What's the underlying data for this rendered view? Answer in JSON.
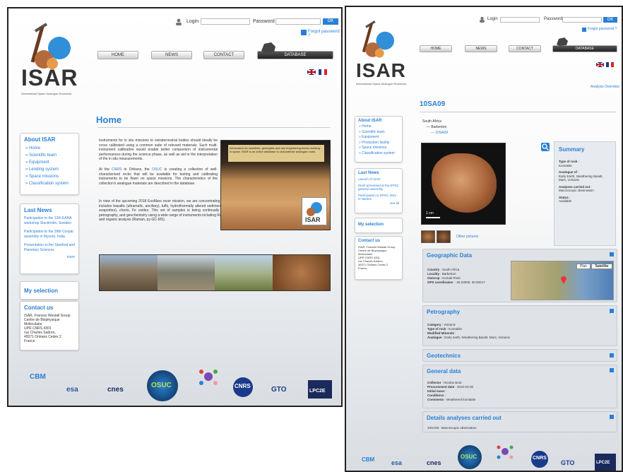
{
  "header": {
    "login_label": "Login",
    "password_label": "Password",
    "ok_label": "OK",
    "forgot_password": "Forgot password ?",
    "logo_text": "ISAR",
    "logo_subtitle": "International Space Analogue Rockstore"
  },
  "nav": {
    "home": "HOME",
    "news": "NEWS",
    "contact": "CONTACT",
    "database": "DATABASE"
  },
  "languages": [
    "en-flag-icon",
    "fr-flag-icon"
  ],
  "left_page": {
    "title": "Home",
    "intro_1": "Instruments for in situ missions to extraterrestrial bodies should ideally be cross calibrated using a common suite of relevant materials. Such multi-instrument calibration would enable better comparison of instrumental performances during the science phase, as well as aid in the interpretation of the in situ measurements.",
    "intro_2_prefix": "At the",
    "cnrs": "CNRS",
    "intro_2_mid": "in Orléans, the",
    "osuc": "OSUC",
    "intro_2_rest": "is creating a collection of well-characterised rocks that will be available for testing and calibrating instruments to be flown on space missions. The characteristics of the collection's analogue materials are described in the database.",
    "intro_3": "In view of the upcoming 2018 ExoMars rover mission, we are concentrating initially on materials of direct relevance to Mars. The initial collection includes basaltic (ultramafic, ancillary), tuffs, hydrothermally altered sediments, volcanic, sedimentary, banded iron formations, sub-surface (chert, evaporites), cherts, Fe oxides. This set of samples is being continually increased. All samples have been characterised with microscopy, petrography, and geochemistry using a wide range of instruments including Raman and IR spectrometry, elemental analysis (SEM, microprobe, ICP) and organic analysis (Raman, py-GC-MS).",
    "feature_caption": "Information for scientists, geologists and any engineering teams working in space. ISAR is an online database to characterise analogue rocks.",
    "about": {
      "title": "About ISAR",
      "items": [
        "Home",
        "Scientific team",
        "Equipment",
        "Lending system",
        "Space missions",
        "Classification system"
      ]
    },
    "news": {
      "title": "Last News",
      "items": [
        "Participation to the 12th EANA workshop Stockholm, Sweden",
        "Participation to the 39th Cospar assembly in Mysore, India",
        "Presentation to the Stanford and Planetary Sciences"
      ],
      "more": "more"
    },
    "my_selection": "My selection",
    "contact": {
      "title": "Contact us",
      "lines": [
        "ISAR, Frances Westall Group",
        "Centre de Biophysique",
        "Moléculaire",
        "UPR CNRS 4301",
        "rue Charles Sadron,",
        "45071 Orléans Cedex 2",
        "France"
      ]
    }
  },
  "right_page": {
    "analyses_link": "Analysis Overview",
    "sample_id": "10SA09",
    "breadcrumb": [
      "South Africa",
      "Barberton",
      "10SA09"
    ],
    "scale_bar": "1 cm",
    "other_pictures": "Other pictures",
    "summary": {
      "title": "Summary",
      "rows": [
        {
          "k": "Type of rock",
          "v": "Komatiite"
        },
        {
          "k": "Analogue of",
          "v": "Early Earth, Weathering Basalt, Mars, Volcanic"
        },
        {
          "k": "Analyses carried out",
          "v": "Macroscopic observation"
        },
        {
          "k": "Status",
          "v": "Available"
        }
      ]
    },
    "about": {
      "title": "About ISAR",
      "items": [
        "Home",
        "Scientific team",
        "Equipment",
        "Production facility",
        "Space missions",
        "Classification system"
      ]
    },
    "news": {
      "title": "Last News",
      "items": [
        "Launch of ISAR",
        "ISAR presented at the EPSC general assembly",
        "Participation to EPSC 2011 in Nantes"
      ],
      "more": "see all"
    },
    "my_selection": "My selection",
    "contact": {
      "title": "Contact us",
      "lines": [
        "ISAR, Frances Westall Group",
        "Centre de Biophysique",
        "Moléculaire",
        "UPR CNRS 4301",
        "rue Charles Sadron,",
        "45071 Orléans Cedex 2",
        "France"
      ]
    },
    "geo": {
      "title": "Geographic Data",
      "rows": [
        {
          "k": "Country",
          "v": "South Africa"
        },
        {
          "k": "Locality",
          "v": "Barberton"
        },
        {
          "k": "Outcrop",
          "v": "Komati River"
        },
        {
          "k": "GPS coordinates",
          "v": "-25.23000, 30.00017"
        }
      ],
      "map_btn": "Plan",
      "sat_btn": "Satellite"
    },
    "petro": {
      "title": "Petrography",
      "rows": [
        {
          "k": "Category",
          "v": "Volcanic"
        },
        {
          "k": "Type of rock",
          "v": "Komatiite"
        },
        {
          "k": "Modified Minerals",
          "v": ""
        },
        {
          "k": "Analogue",
          "v": "Early earth, Weathering Basalt, Mars, Volcanic"
        }
      ]
    },
    "geochem": {
      "title": "Geotechnics"
    },
    "general": {
      "title": "General data",
      "rows": [
        {
          "k": "Collector",
          "v": "Nicolas Bost"
        },
        {
          "k": "Procurement date",
          "v": "2010-03-30"
        },
        {
          "k": "Initial mass",
          "v": ""
        },
        {
          "k": "Conditions",
          "v": ""
        },
        {
          "k": "Comments",
          "v": "Weathered komatiite"
        }
      ]
    },
    "details": {
      "title": "Details analyses carried out",
      "row": "10SA09 : Macroscopic observation"
    }
  },
  "partners": [
    "CBM",
    "esa",
    "cnes",
    "OSUC",
    "CNRS",
    "GTO",
    "LPC2E"
  ],
  "colors": {
    "accent": "#2a7fd4",
    "panel_border": "#cccccc"
  }
}
